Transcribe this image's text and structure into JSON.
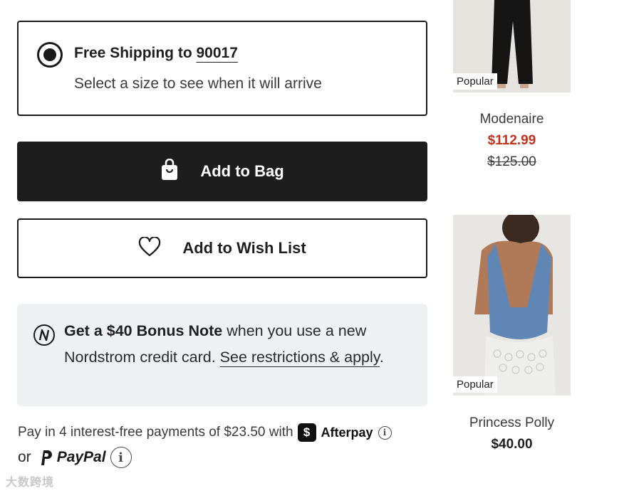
{
  "shipping": {
    "title_prefix": "Free Shipping to ",
    "zip": "90017",
    "subtitle": "Select a size to see when it will arrive",
    "selected": true
  },
  "actions": {
    "add_to_bag": "Add to Bag",
    "add_to_wishlist": "Add to Wish List"
  },
  "bonus": {
    "bold": "Get a $40 Bonus Note",
    "text": " when you use a new Nordstrom credit card. ",
    "link": "See restrictions & apply",
    "end": "."
  },
  "payment": {
    "line1": "Pay in 4 interest-free payments of $23.50 with",
    "afterpay_badge": "$",
    "afterpay": "Afterpay",
    "or": "or",
    "paypal": "PayPal",
    "info_glyph": "i"
  },
  "recommendations": [
    {
      "badge": "Popular",
      "brand": "Modenaire",
      "sale_price": "$112.99",
      "original_price": "$125.00"
    },
    {
      "badge": "Popular",
      "brand": "Princess Polly",
      "price": "$40.00"
    }
  ],
  "watermark": "大数跨境",
  "colors": {
    "sale": "#c4311b",
    "button_dark": "#1d1d1d",
    "bonus_bg": "#eef1f4"
  }
}
